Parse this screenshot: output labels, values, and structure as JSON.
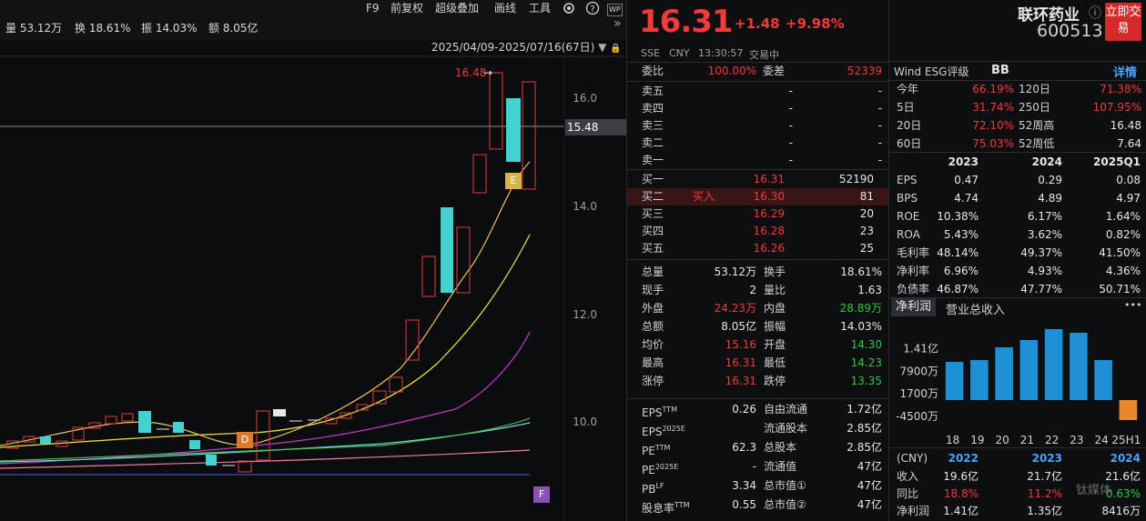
{
  "toolbar": {
    "f9": "F9",
    "fq": "前复权",
    "super": "超级叠加",
    "draw": "画线",
    "tools": "工具",
    "wp": "WP"
  },
  "stats": {
    "vol": "量 53.12万",
    "turn": "换 18.61%",
    "amp": "振 14.03%",
    "amt": "额 8.05亿"
  },
  "range": "2025/04/09-2025/07/16(67日)",
  "price_labels": [
    "16.0",
    "15.48",
    "14.0",
    "12.0",
    "10.0"
  ],
  "high_marker": "16.48",
  "markers": {
    "D": "D",
    "E": "E",
    "F": "F"
  },
  "quote": {
    "price": "16.31",
    "change": "+1.48",
    "pct": "+9.98%",
    "exchange": "SSE",
    "currency": "CNY",
    "time": "13:30:57",
    "status": "交易中",
    "name": "联环药业",
    "code": "600513",
    "trade_btn": "立即交易",
    "wb_label": "委比",
    "wb": "100.00%",
    "wc_label": "委差",
    "wc": "52339",
    "asks": [
      {
        "label": "卖五",
        "price": "-",
        "vol": "-"
      },
      {
        "label": "卖四",
        "price": "-",
        "vol": "-"
      },
      {
        "label": "卖三",
        "price": "-",
        "vol": "-"
      },
      {
        "label": "卖二",
        "price": "-",
        "vol": "-"
      },
      {
        "label": "卖一",
        "price": "-",
        "vol": "-"
      }
    ],
    "bids": [
      {
        "label": "买一",
        "tag": "",
        "price": "16.31",
        "vol": "52190"
      },
      {
        "label": "买二",
        "tag": "买入",
        "price": "16.30",
        "vol": "81"
      },
      {
        "label": "买三",
        "tag": "",
        "price": "16.29",
        "vol": "20"
      },
      {
        "label": "买四",
        "tag": "",
        "price": "16.28",
        "vol": "23"
      },
      {
        "label": "买五",
        "tag": "",
        "price": "16.26",
        "vol": "25"
      }
    ],
    "details": [
      {
        "l1": "总量",
        "v1": "53.12万",
        "l2": "换手",
        "v2": "18.61%",
        "c1": "white",
        "c2": "white"
      },
      {
        "l1": "现手",
        "v1": "2",
        "l2": "量比",
        "v2": "1.63",
        "c1": "white",
        "c2": "white"
      },
      {
        "l1": "外盘",
        "v1": "24.23万",
        "l2": "内盘",
        "v2": "28.89万",
        "c1": "red",
        "c2": "green"
      },
      {
        "l1": "总额",
        "v1": "8.05亿",
        "l2": "振幅",
        "v2": "14.03%",
        "c1": "white",
        "c2": "white"
      },
      {
        "l1": "均价",
        "v1": "15.16",
        "l2": "开盘",
        "v2": "14.30",
        "c1": "red",
        "c2": "green"
      },
      {
        "l1": "最高",
        "v1": "16.31",
        "l2": "最低",
        "v2": "14.23",
        "c1": "red",
        "c2": "green"
      },
      {
        "l1": "涨停",
        "v1": "16.31",
        "l2": "跌停",
        "v2": "13.35",
        "c1": "red",
        "c2": "green"
      }
    ],
    "fund": [
      {
        "l1": "EPS",
        "s1": "TTM",
        "v1": "0.26",
        "l2": "自由流通",
        "v2": "1.72亿"
      },
      {
        "l1": "EPS",
        "s1": "2025E",
        "v1": "",
        "l2": "流通股本",
        "v2": "2.85亿"
      },
      {
        "l1": "PE",
        "s1": "TTM",
        "v1": "62.3",
        "l2": "总股本",
        "v2": "2.85亿"
      },
      {
        "l1": "PE",
        "s1": "2025E",
        "v1": "-",
        "l2": "流通值",
        "v2": "47亿"
      },
      {
        "l1": "PB",
        "s1": "LF",
        "v1": "3.34",
        "l2": "总市值①",
        "v2": "47亿"
      },
      {
        "l1": "股息率",
        "s1": "TTM",
        "v1": "0.55",
        "l2": "总市值②",
        "v2": "47亿"
      }
    ]
  },
  "right": {
    "esg_label": "Wind ESG评级",
    "esg": "BB",
    "detail": "详情",
    "perf": [
      {
        "l1": "今年",
        "v1": "66.19%",
        "l2": "120日",
        "v2": "71.38%",
        "c2": "red"
      },
      {
        "l1": "5日",
        "v1": "31.74%",
        "l2": "250日",
        "v2": "107.95%",
        "c2": "red"
      },
      {
        "l1": "20日",
        "v1": "72.10%",
        "l2": "52周高",
        "v2": "16.48",
        "c2": "white"
      },
      {
        "l1": "60日",
        "v1": "75.03%",
        "l2": "52周低",
        "v2": "7.64",
        "c2": "white"
      }
    ],
    "years": [
      "2023",
      "2024",
      "2025Q1"
    ],
    "metrics": [
      {
        "name": "EPS",
        "vals": [
          "0.47",
          "0.29",
          "0.08"
        ]
      },
      {
        "name": "BPS",
        "vals": [
          "4.74",
          "4.89",
          "4.97"
        ]
      },
      {
        "name": "ROE",
        "vals": [
          "10.38%",
          "6.17%",
          "1.64%"
        ]
      },
      {
        "name": "ROA",
        "vals": [
          "5.43%",
          "3.62%",
          "0.82%"
        ]
      },
      {
        "name": "毛利率",
        "vals": [
          "48.14%",
          "49.37%",
          "41.50%"
        ]
      },
      {
        "name": "净利率",
        "vals": [
          "6.96%",
          "4.93%",
          "4.36%"
        ]
      },
      {
        "name": "负债率",
        "vals": [
          "46.87%",
          "47.77%",
          "50.71%"
        ]
      }
    ],
    "tabs": [
      "净利润",
      "营业总收入"
    ],
    "more": "•••",
    "chart_data": {
      "type": "bar",
      "categories": [
        "18",
        "19",
        "20",
        "21",
        "22",
        "23",
        "24",
        "25H1"
      ],
      "values": [
        1.05,
        1.1,
        1.45,
        1.65,
        1.95,
        1.85,
        1.1,
        -0.55
      ],
      "yticks": [
        "1.41亿",
        "7900万",
        "1700万",
        "-4500万"
      ],
      "ylim": [
        -0.75,
        1.95
      ]
    },
    "income_years": [
      "(CNY)",
      "2022",
      "2023",
      "2024"
    ],
    "income": [
      {
        "name": "收入",
        "vals": [
          "19.6亿",
          "21.7亿",
          "21.6亿"
        ],
        "cls": [
          "white",
          "white",
          "white"
        ]
      },
      {
        "name": "同比",
        "vals": [
          "18.8%",
          "11.2%",
          "0.63%"
        ],
        "cls": [
          "red",
          "red",
          "green"
        ]
      },
      {
        "name": "净利润",
        "vals": [
          "1.41亿",
          "1.35亿",
          "8416万"
        ],
        "cls": [
          "white",
          "white",
          "white"
        ]
      }
    ],
    "watermark": "钛媒体"
  }
}
